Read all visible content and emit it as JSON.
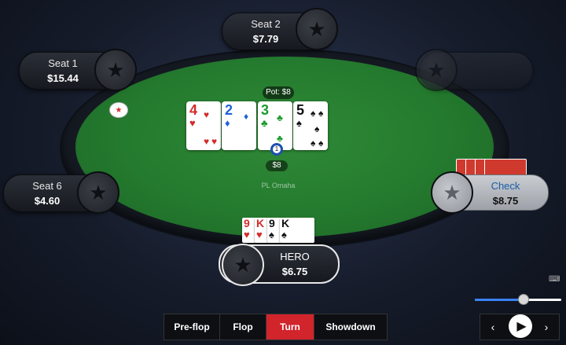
{
  "table": {
    "game": "PL Omaha",
    "pot_label": "Pot: $8",
    "bet_label": "$8",
    "bet_chip_count": "1"
  },
  "seats": [
    {
      "id": "seat2",
      "name": "Seat 2",
      "stack": "$7.79"
    },
    {
      "id": "seat1",
      "name": "Seat 1",
      "stack": "$15.44"
    },
    {
      "id": "seat6",
      "name": "Seat 6",
      "stack": "$4.60"
    },
    {
      "id": "seat_right",
      "name": "Check",
      "stack": "$8.75"
    },
    {
      "id": "hero",
      "name": "HERO",
      "stack": "$6.75"
    }
  ],
  "board": [
    {
      "rank": "4",
      "suit": "♥",
      "color": "red"
    },
    {
      "rank": "2",
      "suit": "♦",
      "color": "blue"
    },
    {
      "rank": "3",
      "suit": "♣",
      "color": "green"
    },
    {
      "rank": "5",
      "suit": "♠",
      "color": "black"
    }
  ],
  "hero_cards": [
    {
      "rank": "9",
      "suit": "♥",
      "color": "red"
    },
    {
      "rank": "K",
      "suit": "♥",
      "color": "red"
    },
    {
      "rank": "9",
      "suit": "♠",
      "color": "black"
    },
    {
      "rank": "K",
      "suit": "♠",
      "color": "black"
    }
  ],
  "streets": [
    "Pre-flop",
    "Flop",
    "Turn",
    "Showdown"
  ],
  "active_street": "Turn",
  "replay": {
    "speed_level": 0.55,
    "prev_icon": "chevron-left-icon",
    "play_icon": "play-icon",
    "next_icon": "chevron-right-icon"
  },
  "colors": {
    "felt": "#247a2e",
    "active_street": "#d1242b",
    "slider_fill": "#3b82f6"
  }
}
